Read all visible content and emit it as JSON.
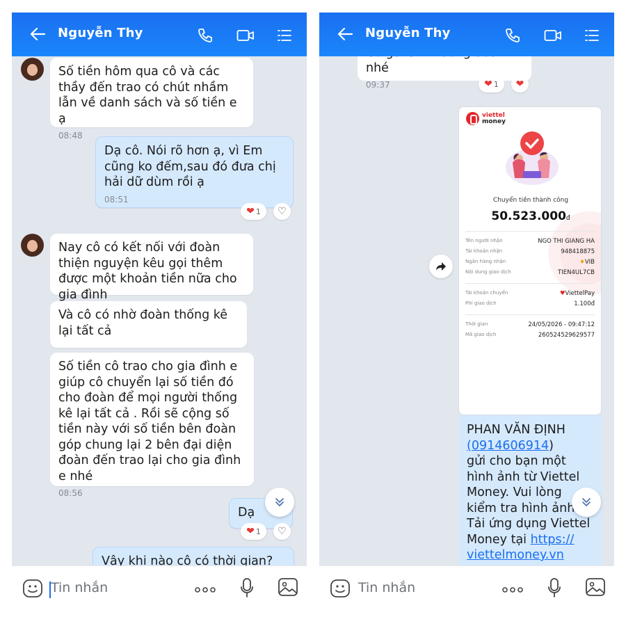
{
  "left": {
    "header": {
      "name": "Nguyễn Thy"
    },
    "messages": {
      "m1_text": "Số tiền hôm qua cô và các thầy đến trao có chút nhầm lẫn về danh sách và số tiền e ạ",
      "m1_time": "08:48",
      "m2_text": "Dạ cô. Nói rõ hơn ạ, vì Em cũng ko đếm,sau đó đưa chị hải dữ dùm rồi ạ",
      "m2_time": "08:51",
      "m2_react_count": "1",
      "m3_text": "Nay cô có kết nối với đoàn thiện nguyện kêu gọi thêm được một khoản tiền nữa cho gia đình",
      "m4_text": "Và cô có nhờ đoàn thống kê lại tất cả",
      "m5_text": "Số tiền cô trao cho gia đình e giúp cô chuyển lại số tiền đó cho đoàn để mọi người thống kê lại tất cả . Rồi sẽ cộng số tiền này với số tiền bên đoàn góp chung lại 2 bên đại diện đoàn đến trao lại cho gia đình e nhé",
      "m5_time": "08:56",
      "m6_text": "Dạ",
      "m6_react_count": "1",
      "m7_text": "Vậy khi nào cô  có thời gian? để"
    },
    "input": {
      "placeholder": "Tin nhắn"
    }
  },
  "right": {
    "header": {
      "name": "Nguyễn Thy"
    },
    "top_message": {
      "text": "Cô gửi stk trưởng đoàn nhé",
      "time": "09:37",
      "react_count": "1"
    },
    "receipt": {
      "brand_line1": "viettel",
      "brand_line2": "money",
      "status": "Chuyển tiền thành công",
      "amount": "50.523.000",
      "currency": "đ",
      "rows": [
        {
          "label": "Tên người nhận",
          "value": "NGO THI GIANG HA"
        },
        {
          "label": "Tài khoản nhận",
          "value": "948418875"
        },
        {
          "label": "Ngân hàng nhận",
          "value": "VIB"
        },
        {
          "label": "Nội dung giao dịch",
          "value": "TIEN4UL7CB"
        },
        {
          "label": "Tài khoản chuyển",
          "value": "ViettelPay"
        },
        {
          "label": "Phí giao dịch",
          "value": "1.100đ"
        },
        {
          "label": "Thời gian",
          "value": "24/05/2026 - 09:47:12"
        },
        {
          "label": "Mã giao dịch",
          "value": "260524529629577"
        }
      ]
    },
    "sms": {
      "sender": "PHAN VĂN ĐỊNH",
      "phone": "(0914606914",
      "phone_close": ")",
      "body1": "gửi cho bạn một hình ảnh từ Viettel Money. Vui lòng kiểm tra hình ảnh. Tải ứng dụng Viettel Money tại ",
      "link1": "https://",
      "link2": "viettelmoney.vn"
    },
    "input": {
      "placeholder": "Tin nhắn"
    }
  },
  "colors": {
    "header": "#1a7cf5",
    "chat_bg": "#e2e6ed",
    "my_bubble": "#d5e9fd",
    "heart": "#e53935",
    "brand_red": "#e3262b"
  }
}
